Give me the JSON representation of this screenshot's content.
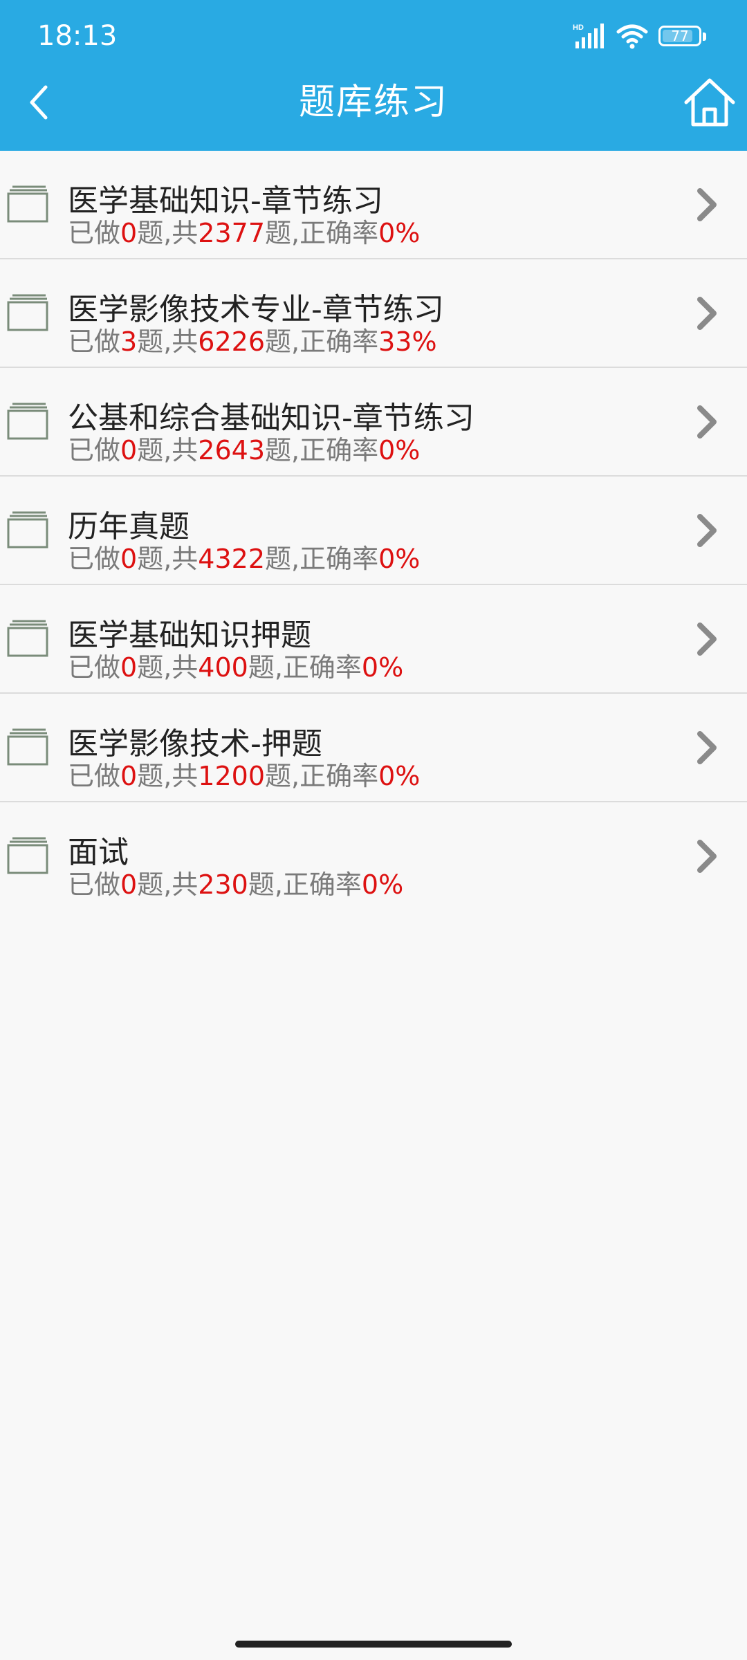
{
  "status_bar": {
    "time": "18:13",
    "network_label": "HD",
    "battery_level": "77",
    "icons": [
      "signal-icon",
      "wifi-icon",
      "battery-icon"
    ]
  },
  "header": {
    "title": "题库练习",
    "back_icon": "chevron-left-icon",
    "home_icon": "home-icon",
    "background_color": "#29aae3"
  },
  "items": [
    {
      "title": "医学基础知识-章节练习",
      "done_prefix": "已做",
      "done": "0",
      "mid": "题,共",
      "total": "2377",
      "rate_prefix": "题,正确率",
      "rate": "0%"
    },
    {
      "title": "医学影像技术专业-章节练习",
      "done_prefix": "已做",
      "done": "3",
      "mid": "题,共",
      "total": "6226",
      "rate_prefix": "题,正确率",
      "rate": "33%"
    },
    {
      "title": "公基和综合基础知识-章节练习",
      "done_prefix": "已做",
      "done": "0",
      "mid": "题,共",
      "total": "2643",
      "rate_prefix": "题,正确率",
      "rate": "0%"
    },
    {
      "title": "历年真题",
      "done_prefix": "已做",
      "done": "0",
      "mid": "题,共",
      "total": "4322",
      "rate_prefix": "题,正确率",
      "rate": "0%"
    },
    {
      "title": "医学基础知识押题",
      "done_prefix": "已做",
      "done": "0",
      "mid": "题,共",
      "total": "400",
      "rate_prefix": "题,正确率",
      "rate": "0%"
    },
    {
      "title": "医学影像技术-押题",
      "done_prefix": "已做",
      "done": "0",
      "mid": "题,共",
      "total": "1200",
      "rate_prefix": "题,正确率",
      "rate": "0%"
    },
    {
      "title": "面试",
      "done_prefix": "已做",
      "done": "0",
      "mid": "题,共",
      "total": "230",
      "rate_prefix": "题,正确率",
      "rate": "0%"
    }
  ],
  "colors": {
    "accent": "#29aae3",
    "highlight_number": "#dd1111",
    "secondary_text": "#7a7a7a"
  }
}
